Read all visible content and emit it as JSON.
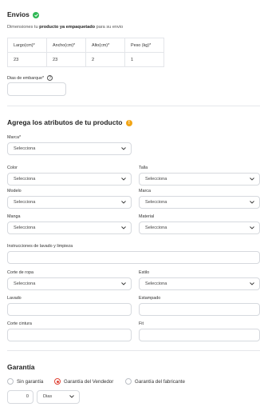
{
  "envios": {
    "title": "Envios",
    "desc_prefix": "Dimensiones tu ",
    "desc_bold": "producto ya empaquetado",
    "desc_suffix": " para su envio",
    "table": {
      "headers": [
        "Largo(cm)*",
        "Ancho(cm)*",
        "Alto(cm)*",
        "Peso (kg)*"
      ],
      "values": [
        "23",
        "23",
        "2",
        "1"
      ]
    },
    "dias_label": "Dias de embarque*",
    "dias_value": ""
  },
  "atributos": {
    "title": "Agrega los atributos de tu producto",
    "fields": {
      "marca1": {
        "label": "Marca*",
        "value": "Selecciona"
      },
      "color": {
        "label": "Color",
        "value": "Selecciona"
      },
      "talla": {
        "label": "Talla",
        "value": "Selecciona"
      },
      "modelo": {
        "label": "Modelo",
        "value": "Selecciona"
      },
      "marca2": {
        "label": "Marca",
        "value": "Selecciona"
      },
      "manga": {
        "label": "Manga",
        "value": "Selecciona"
      },
      "material": {
        "label": "Material",
        "value": "Selecciona"
      },
      "instrucciones": {
        "label": "Instrucciones de lavado y limpieza",
        "value": ""
      },
      "corte": {
        "label": "Corte de ropa",
        "value": "Selecciona"
      },
      "estilo": {
        "label": "Estilo",
        "value": "Selecciona"
      },
      "lavado": {
        "label": "Lavado",
        "value": ""
      },
      "estampado": {
        "label": "Estampado",
        "value": ""
      },
      "corte_cintura": {
        "label": "Corte cintura",
        "value": ""
      },
      "fit": {
        "label": "Fit",
        "value": ""
      }
    }
  },
  "garantia": {
    "title": "Garantía",
    "options": [
      "Sin garantía",
      "Garantía del Vendedor",
      "Garantía del fabricante"
    ],
    "selected_index": 1,
    "amount": "0",
    "unit": "Dias"
  },
  "colors": {
    "accent_red": "#e04335",
    "check_green": "#2fb855",
    "warn_orange": "#f2a516"
  },
  "icons": [
    "check-circle-icon",
    "help-icon",
    "warning-icon",
    "chevron-down-icon"
  ]
}
